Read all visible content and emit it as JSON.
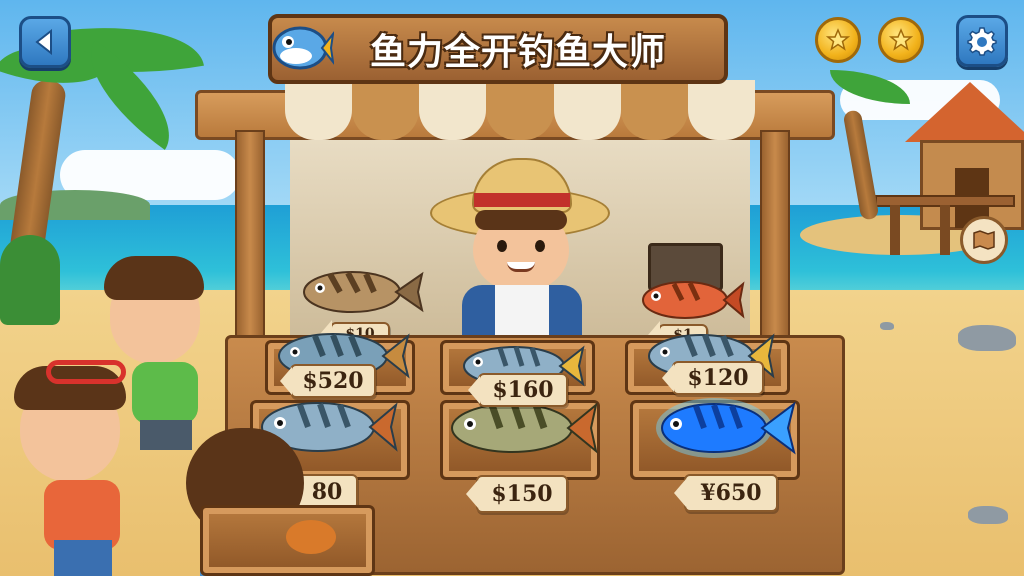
{
  "game": {
    "title": "鱼力全开钓鱼大师"
  },
  "hud": {
    "back_icon": "back-arrow-icon",
    "coin_icon": "star-coin-icon",
    "settings_icon": "gear-icon",
    "map_icon": "map-icon"
  },
  "stall": {
    "price_tags": [
      {
        "label": "$520"
      },
      {
        "label": "$160"
      },
      {
        "label": "$120"
      },
      {
        "label": "80"
      },
      {
        "label": "$150"
      },
      {
        "label": "¥650"
      }
    ],
    "partial_tags": [
      {
        "label": "$10"
      },
      {
        "label": "$1"
      }
    ]
  },
  "colors": {
    "accent_blue": "#2f78c0",
    "wood": "#9b6132",
    "coin_gold": "#f2b21b",
    "rare_fish": "#1e7bff"
  }
}
